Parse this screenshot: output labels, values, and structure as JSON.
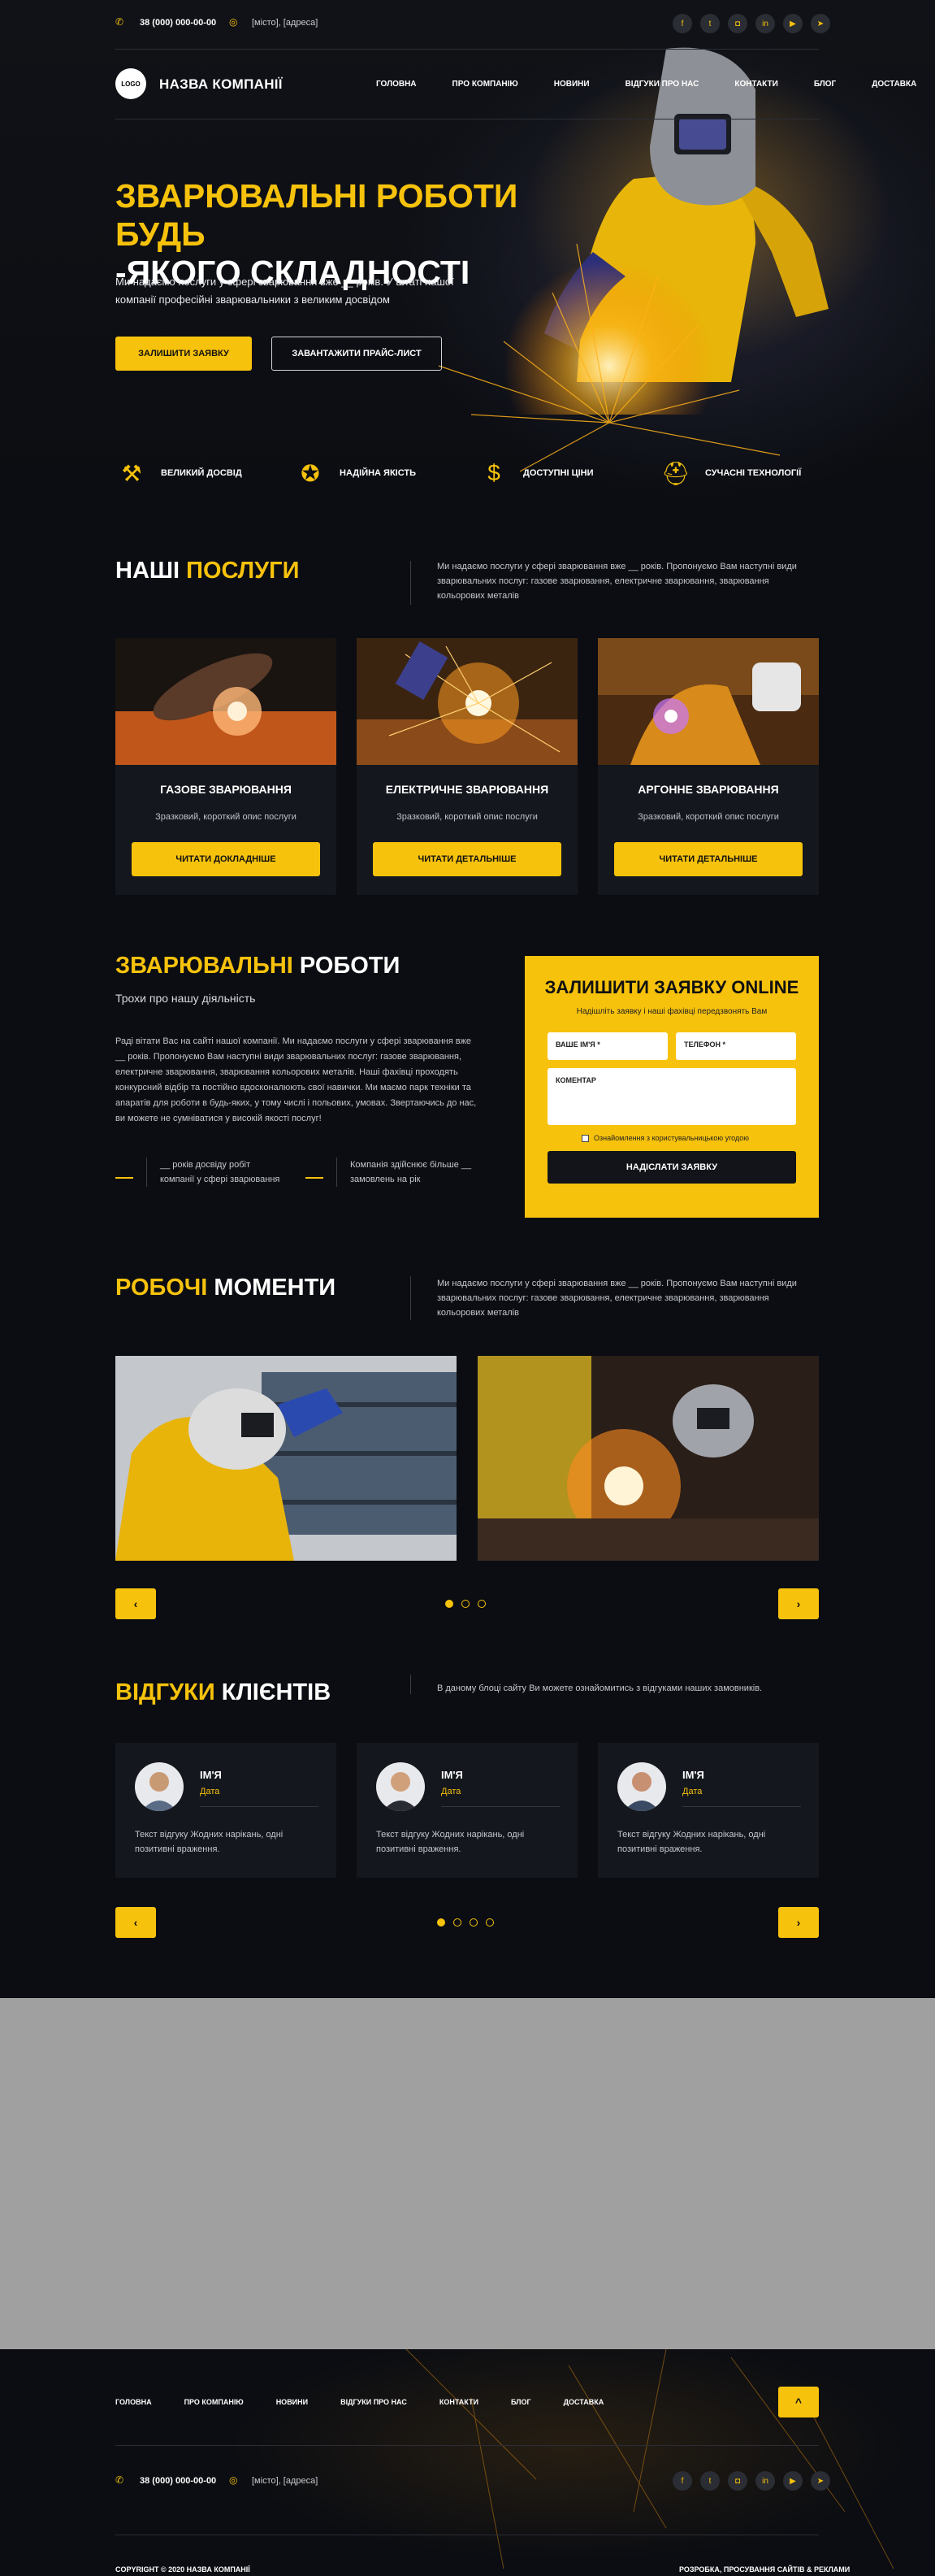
{
  "topbar": {
    "phone": "38 (000) 000-00-00",
    "address": "[місто], [адреса]",
    "social": [
      "fb",
      "tw",
      "ig",
      "in",
      "yt",
      "tg"
    ]
  },
  "header": {
    "logo_text": "LOGO",
    "company_name": "НАЗВА КОМПАНІЇ",
    "nav": [
      "ГОЛОВНА",
      "ПРО КОМПАНІЮ",
      "НОВИНИ",
      "ВІДГУКИ ПРО НАС",
      "КОНТАКТИ",
      "БЛОГ",
      "ДОСТАВКА"
    ]
  },
  "hero": {
    "title_line1": "ЗВАРЮВАЛЬНІ РОБОТИ БУДЬ",
    "title_line2": "-ЯКОГО СКЛАДНОСТІ",
    "text": "Ми надаємо послуги у сфері зварювання вже __ років. У штаті нашої компанії професійні зварювальники з великим досвідом",
    "btn_primary": "ЗАЛИШИТИ ЗАЯВКУ",
    "btn_secondary": "ЗАВАНТАЖИТИ ПРАЙС-ЛИСТ"
  },
  "features": [
    {
      "icon": "welder-icon",
      "label": "ВЕЛИКИЙ ДОСВІД"
    },
    {
      "icon": "star-laurel-icon",
      "label": "НАДІЙНА ЯКІСТЬ"
    },
    {
      "icon": "coins-icon",
      "label": "ДОСТУПНІ ЦІНИ"
    },
    {
      "icon": "helmet-icon",
      "label": "СУЧАСНІ ТЕХНОЛОГІЇ"
    }
  ],
  "services": {
    "title_white": "НАШІ ",
    "title_yellow": "ПОСЛУГИ",
    "description": "Ми надаємо послуги у сфері зварювання вже __ років. Пропонуємо Вам наступні види зварювальних послуг: газове зварювання, електричне зварювання, зварювання кольорових металів",
    "cards": [
      {
        "title": "ГАЗОВЕ ЗВАРЮВАННЯ",
        "text": "Зразковий, короткий опис послуги",
        "button": "ЧИТАТИ ДОКЛАДНІШЕ"
      },
      {
        "title": "ЕЛЕКТРИЧНЕ ЗВАРЮВАННЯ",
        "text": "Зразковий, короткий опис послуги",
        "button": "ЧИТАТИ ДЕТАЛЬНІШЕ"
      },
      {
        "title": "АРГОННЕ ЗВАРЮВАННЯ",
        "text": "Зразковий, короткий опис послуги",
        "button": "ЧИТАТИ ДЕТАЛЬНІШЕ"
      }
    ]
  },
  "about": {
    "title_yellow": "ЗВАРЮВАЛЬНІ",
    "title_white": " РОБОТИ",
    "subtitle": "Трохи про нашу діяльність",
    "text": "Раді вітати Вас на сайті нашої компанії. Ми надаємо послуги у сфері зварювання вже __ років. Пропонуємо Вам наступні види зварювальних послуг: газове зварювання, електричне зварювання, зварювання кольорових металів. Наші фахівці проходять конкурсний відбір та постійно вдосконалюють свої навички. Ми маємо парк техніки та апаратів для роботи в будь-яких, у тому числі і польових, умовах. Звертаючись до нас, ви можете не сумніватися у високій якості послуг!",
    "stats": [
      "__ років досвіду робіт компанії у сфері зварювання",
      "Компанія здійснює більше __ замовлень на рік"
    ]
  },
  "form": {
    "title": "ЗАЛИШИТИ ЗАЯВКУ ONLINE",
    "subtitle": "Надішліть заявку і наші фахівці передзвонять Вам",
    "name_placeholder": "ВАШЕ ІМ'Я *",
    "phone_placeholder": "ТЕЛЕФОН *",
    "comment_placeholder": "КОМЕНТАР",
    "agree": "Ознайомлення з користувальницькою угодою",
    "submit": "НАДІСЛАТИ ЗАЯВКУ"
  },
  "gallery": {
    "title_yellow": "РОБОЧІ",
    "title_white": " МОМЕНТИ",
    "description": "Ми надаємо послуги у сфері зварювання вже __ років. Пропонуємо Вам наступні види зварювальних послуг: газове зварювання, електричне зварювання, зварювання кольорових металів",
    "prev": "‹",
    "next": "›",
    "dots": 3,
    "active_dot": 0
  },
  "reviews": {
    "title_yellow": "ВІДГУКИ",
    "title_white": " КЛІЄНТІВ",
    "description": "В даному блоці сайту Ви можете ознайомитись з відгуками наших замовників.",
    "items": [
      {
        "name": "ІМ'Я",
        "date": "Дата",
        "text": "Текст відгуку Жодних нарікань, одні позитивні враження."
      },
      {
        "name": "ІМ'Я",
        "date": "Дата",
        "text": "Текст відгуку Жодних нарікань, одні позитивні враження."
      },
      {
        "name": "ІМ'Я",
        "date": "Дата",
        "text": "Текст відгуку Жодних нарікань, одні позитивні враження."
      }
    ],
    "prev": "‹",
    "next": "›",
    "dots": 4,
    "active_dot": 0
  },
  "footer": {
    "nav": [
      "ГОЛОВНА",
      "ПРО КОМПАНІЮ",
      "НОВИНИ",
      "ВІДГУКИ ПРО НАС",
      "КОНТАКТИ",
      "БЛОГ",
      "ДОСТАВКА"
    ],
    "to_top": "^",
    "phone": "38 (000) 000-00-00",
    "address": "[місто], [адреса]",
    "copyright": "COPYRIGHT © 2020 НАЗВА КОМПАНІЇ",
    "dev": "РОЗРОБКА, ПРОСУВАННЯ САЙТІВ & РЕКЛАМИ"
  },
  "colors": {
    "accent": "#f7c20c",
    "bg": "#0b0d12",
    "card": "#14171d",
    "placeholder_block": "#a0a0a0"
  }
}
